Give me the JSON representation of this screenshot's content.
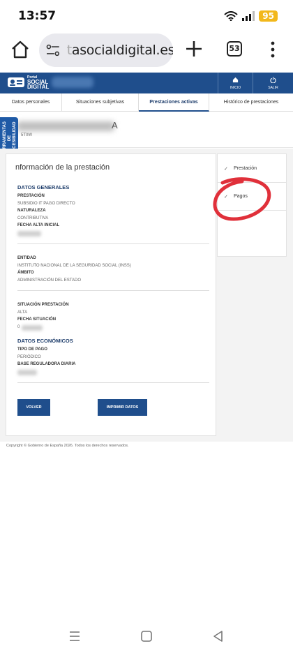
{
  "status": {
    "time": "13:57",
    "battery": "95"
  },
  "browser": {
    "url_faint": "t",
    "url": "asocialdigital.es",
    "tab_count": "53"
  },
  "site": {
    "logo_top": "Portal",
    "logo_line1": "SOCIAL",
    "logo_line2": "DIGITAL",
    "inicio": "INICIO",
    "salir": "SALIR"
  },
  "tabs": [
    {
      "label": "Datos personales"
    },
    {
      "label": "Situaciones subjetivas"
    },
    {
      "label": "Prestaciones activas"
    },
    {
      "label": "Histórico de prestaciones"
    }
  ],
  "person": {
    "name_tail": "A",
    "id": "5T0W"
  },
  "accessibility": {
    "label": "HERRAMIENTAS DE ACCESIBILIDAD"
  },
  "card": {
    "title": "nformación de la prestación",
    "general_heading": "DATOS GENERALES",
    "prestacion_label": "PRESTACIÓN",
    "prestacion_value": "SUBSIDIO IT PAGO DIRECTO",
    "naturaleza_label": "NATURALEZA",
    "naturaleza_value": "CONTRIBUTIVA",
    "fecha_alta_label": "FECHA ALTA INICIAL",
    "entidad_label": "ENTIDAD",
    "entidad_value": "INSTITUTO NACIONAL DE LA SEGURIDAD SOCIAL (INSS)",
    "ambito_label": "ÁMBITO",
    "ambito_value": "ADMINISTRACIÓN DEL ESTADO",
    "situacion_label": "SITUACIÓN PRESTACIÓN",
    "situacion_value": "ALTA",
    "fecha_situacion_label": "FECHA SITUACIÓN",
    "fecha_situacion_value": "0",
    "economicos_heading": "DATOS ECONÓMICOS",
    "tipo_pago_label": "TIPO DE PAGO",
    "tipo_pago_value": "PERIÓDICO",
    "base_label": "BASE REGULADORA DIARIA",
    "volver": "VOLVER",
    "imprimir": "IMPRIMIR DATOS"
  },
  "sidemenu": [
    {
      "label": "Prestación"
    },
    {
      "label": "Pagos"
    }
  ],
  "footer": "Copyright © Gobierno de España 2026. Todos los derechos reservados.",
  "colors": {
    "brand": "#1f4e8c",
    "annotation": "#e0303a"
  }
}
